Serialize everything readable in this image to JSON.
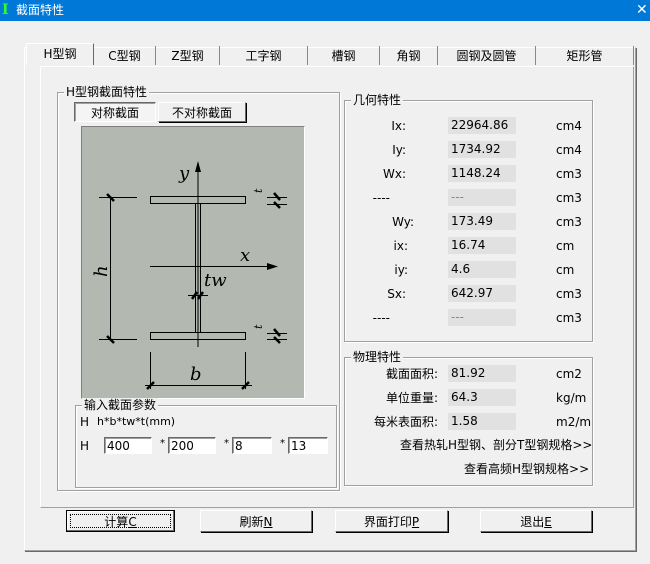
{
  "window": {
    "title": "截面特性",
    "app_icon": "I",
    "close_glyph": "✕"
  },
  "tabs": [
    {
      "label": "H型钢",
      "active": true
    },
    {
      "label": "C型钢",
      "active": false
    },
    {
      "label": "Z型钢",
      "active": false
    },
    {
      "label": "工字钢",
      "active": false
    },
    {
      "label": "槽钢",
      "active": false
    },
    {
      "label": "角钢",
      "active": false
    },
    {
      "label": "圆钢及圆管",
      "active": false
    },
    {
      "label": "矩形管",
      "active": false
    }
  ],
  "section_group": {
    "label": "H型钢截面特性",
    "symmetric_button": "对称截面",
    "asymmetric_button": "不对称截面",
    "selected": "对称截面"
  },
  "diagram": {
    "labels": {
      "y": "y",
      "x": "x",
      "h": "h",
      "b": "b",
      "tw": "tw",
      "t_top": "t",
      "t_bottom": "t"
    }
  },
  "input_group": {
    "label": "输入截面参数",
    "type_label": "H",
    "format_label": "h*b*tw*t(mm)",
    "row_label": "H",
    "separator": "*",
    "fields": [
      {
        "name": "h",
        "value": "400"
      },
      {
        "name": "b",
        "value": "200"
      },
      {
        "name": "tw",
        "value": "8"
      },
      {
        "name": "t",
        "value": "13"
      }
    ]
  },
  "geometry": {
    "label": "几何特性",
    "rows": [
      {
        "label": "Ix:",
        "value": "22964.86",
        "unit": "cm4"
      },
      {
        "label": "Iy:",
        "value": "1734.92",
        "unit": "cm4"
      },
      {
        "label": "Wx:",
        "value": "1148.24",
        "unit": "cm3"
      },
      {
        "label": "----",
        "value": "---",
        "unit": "cm3"
      },
      {
        "label": "Wy:",
        "value": "173.49",
        "unit": "cm3"
      },
      {
        "label": "ix:",
        "value": "16.74",
        "unit": "cm"
      },
      {
        "label": "iy:",
        "value": "4.6",
        "unit": "cm"
      },
      {
        "label": "Sx:",
        "value": "642.97",
        "unit": "cm3"
      },
      {
        "label": "----",
        "value": "---",
        "unit": "cm3"
      }
    ]
  },
  "physical": {
    "label": "物理特性",
    "rows": [
      {
        "label": "截面面积:",
        "value": "81.92",
        "unit": "cm2"
      },
      {
        "label": "单位重量:",
        "value": "64.3",
        "unit": "kg/m"
      },
      {
        "label": "每米表面积:",
        "value": "1.58",
        "unit": "m2/m"
      }
    ],
    "links": [
      "查看热轧H型钢、剖分T型钢规格>>",
      "查看高频H型钢规格>>"
    ]
  },
  "buttons": [
    {
      "text": "计算",
      "accel": "C",
      "default": true
    },
    {
      "text": "刷新",
      "accel": "N",
      "default": false
    },
    {
      "text": "界面打印",
      "accel": "P",
      "default": false
    },
    {
      "text": "退出",
      "accel": "E",
      "default": false
    }
  ]
}
